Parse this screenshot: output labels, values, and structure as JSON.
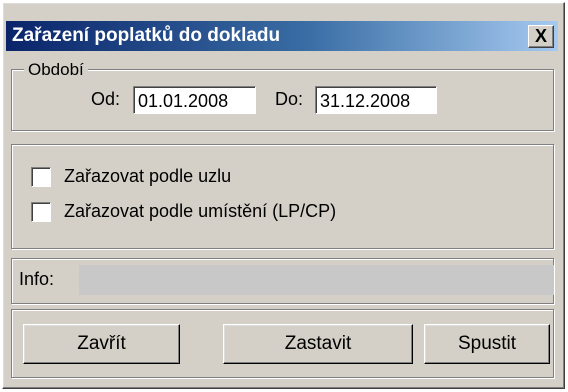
{
  "window": {
    "title": "Zařazení poplatků do dokladu",
    "close_label": "X"
  },
  "period": {
    "legend": "Období",
    "from_label": "Od:",
    "from_value": "01.01.2008",
    "to_label": "Do:",
    "to_value": "31.12.2008"
  },
  "options": [
    {
      "label": "Zařazovat podle uzlu",
      "checked": false
    },
    {
      "label": "Zařazovat podle umístění (LP/CP)",
      "checked": false
    }
  ],
  "info": {
    "label": "Info:",
    "value": ""
  },
  "buttons": {
    "close": "Zavřít",
    "stop": "Zastavit",
    "start": "Spustit"
  }
}
